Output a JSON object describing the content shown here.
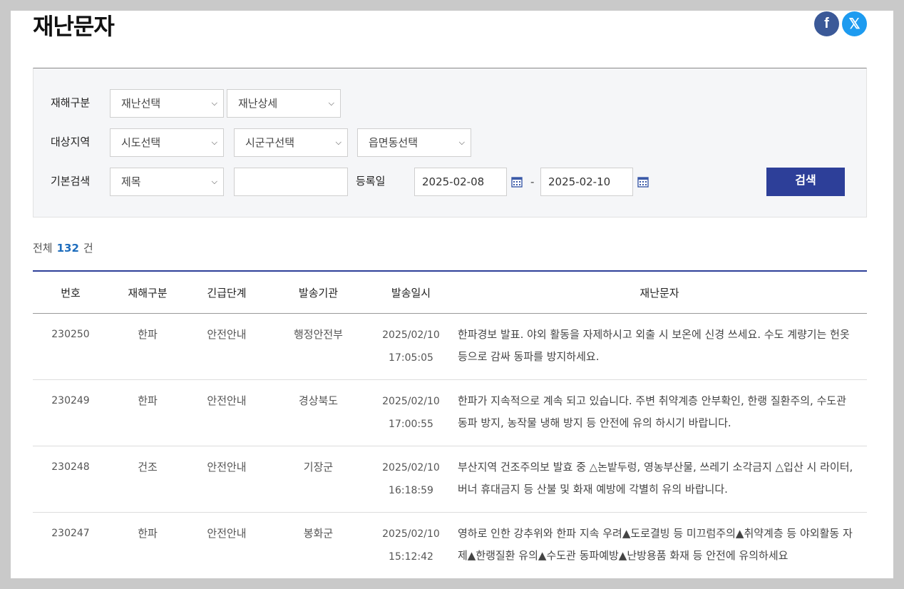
{
  "page": {
    "title": "재난문자"
  },
  "social": {
    "facebook": "f",
    "x": "𝕏"
  },
  "filters": {
    "disaster_type_label": "재해구분",
    "disaster_select": "재난선택",
    "disaster_detail": "재난상세",
    "region_label": "대상지역",
    "sido": "시도선택",
    "sigungu": "시군구선택",
    "eupmyeondong": "읍면동선택",
    "basic_search_label": "기본검색",
    "search_field": "제목",
    "keyword": "",
    "reg_date_label": "등록일",
    "date_from": "2025-02-08",
    "date_sep": "-",
    "date_to": "2025-02-10",
    "search_button": "검색"
  },
  "summary": {
    "total_label": "전체",
    "count": "132",
    "unit": "건"
  },
  "table": {
    "headers": [
      "번호",
      "재해구분",
      "긴급단계",
      "발송기관",
      "발송일시",
      "재난문자"
    ],
    "rows": [
      {
        "no": "230250",
        "type": "한파",
        "level": "안전안내",
        "agency": "행정안전부",
        "date": "2025/02/10",
        "time": "17:05:05",
        "message": "한파경보 발표. 야외 활동을 자제하시고 외출 시 보온에 신경 쓰세요. 수도 계량기는 헌옷 등으로 감싸 동파를 방지하세요."
      },
      {
        "no": "230249",
        "type": "한파",
        "level": "안전안내",
        "agency": "경상북도",
        "date": "2025/02/10",
        "time": "17:00:55",
        "message": "한파가 지속적으로 계속 되고 있습니다. 주변 취약계층 안부확인, 한랭 질환주의, 수도관 동파 방지, 농작물 냉해 방지 등 안전에 유의 하시기 바랍니다."
      },
      {
        "no": "230248",
        "type": "건조",
        "level": "안전안내",
        "agency": "기장군",
        "date": "2025/02/10",
        "time": "16:18:59",
        "message": "부산지역 건조주의보 발효 중 △논밭두렁, 영농부산물, 쓰레기 소각금지 △입산 시 라이터, 버너 휴대금지 등 산불 및 화재 예방에 각별히 유의 바랍니다."
      },
      {
        "no": "230247",
        "type": "한파",
        "level": "안전안내",
        "agency": "봉화군",
        "date": "2025/02/10",
        "time": "15:12:42",
        "message": "영하로 인한 강추위와 한파 지속 우려▲도로결빙 등 미끄럼주의▲취약계층 등 야외활동 자제▲한랭질환 유의▲수도관 동파예방▲난방용품 화재 등 안전에 유의하세요"
      }
    ]
  }
}
